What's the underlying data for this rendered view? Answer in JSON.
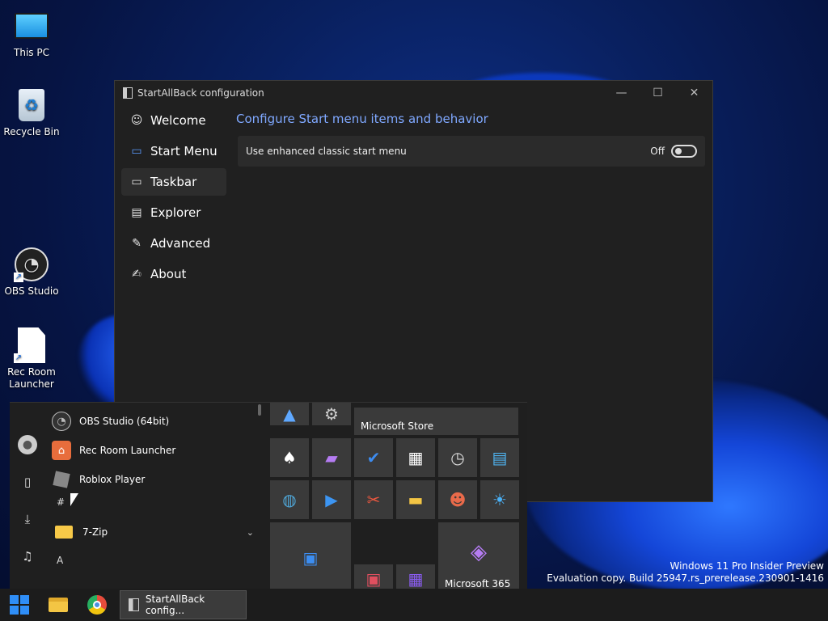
{
  "desktop": {
    "icons": [
      {
        "label": "This PC",
        "icon": "monitor-icon"
      },
      {
        "label": "Recycle Bin",
        "icon": "recycle-bin-icon"
      },
      {
        "label": "OBS Studio",
        "icon": "obs-icon"
      },
      {
        "label": "Rec Room\nLauncher",
        "icon": "document-icon"
      }
    ]
  },
  "window": {
    "title": "StartAllBack configuration",
    "controls": {
      "minimize": "—",
      "maximize": "☐",
      "close": "✕"
    },
    "nav": [
      {
        "label": "Welcome",
        "glyph": "☺"
      },
      {
        "label": "Start Menu",
        "glyph": "▭"
      },
      {
        "label": "Taskbar",
        "glyph": "▭"
      },
      {
        "label": "Explorer",
        "glyph": "▤"
      },
      {
        "label": "Advanced",
        "glyph": "✎"
      },
      {
        "label": "About",
        "glyph": "✍"
      }
    ],
    "heading": "Configure Start menu items and behavior",
    "setting": {
      "label": "Use enhanced classic start menu",
      "state": "Off"
    }
  },
  "start_menu": {
    "apps": [
      {
        "label": "OBS Studio (64bit)"
      },
      {
        "label": "Rec Room Launcher"
      },
      {
        "label": "Roblox Player"
      },
      {
        "label": "7-Zip"
      }
    ],
    "letters": [
      "#",
      "A"
    ],
    "tiles": {
      "store_label": "Microsoft Store",
      "m365_label": "Microsoft 365"
    }
  },
  "taskbar": {
    "task_label": "StartAllBack config..."
  },
  "watermark": {
    "line1": "Windows 11 Pro Insider Preview",
    "line2": "Evaluation copy. Build 25947.rs_prerelease.230901-1416"
  },
  "colors": {
    "accent": "#7fa8ff",
    "window_bg": "#202020",
    "taskbar_bg": "#1c1c1c"
  }
}
